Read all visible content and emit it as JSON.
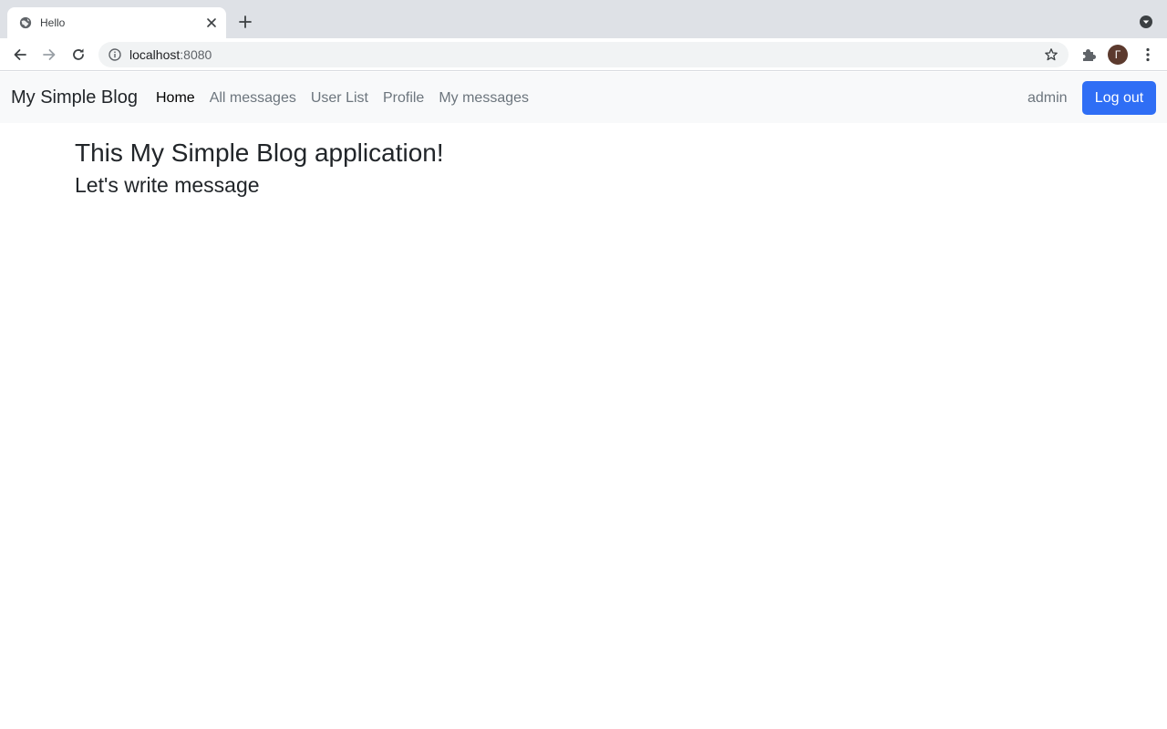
{
  "browser": {
    "tab": {
      "title": "Hello"
    },
    "address_bar": {
      "host": "localhost",
      "port": ":8080"
    },
    "profile_initial": "Г",
    "icons": {
      "favicon": "globe-icon",
      "tab_close": "close-icon",
      "new_tab": "plus-icon",
      "tab_search": "chevron-down-circle-icon",
      "back": "arrow-left-icon",
      "forward": "arrow-right-icon",
      "reload": "reload-icon",
      "site_info": "info-icon",
      "bookmark": "star-icon",
      "extensions": "puzzle-icon",
      "menu": "more-vertical-icon"
    }
  },
  "navbar": {
    "brand": "My Simple Blog",
    "links": [
      {
        "label": "Home",
        "active": true
      },
      {
        "label": "All messages",
        "active": false
      },
      {
        "label": "User List",
        "active": false
      },
      {
        "label": "Profile",
        "active": false
      },
      {
        "label": "My messages",
        "active": false
      }
    ],
    "username": "admin",
    "logout_label": "Log out"
  },
  "main": {
    "heading": "This My Simple Blog application!",
    "subheading": "Let's write message"
  },
  "colors": {
    "primary": "#2f6ef5",
    "navbar_bg": "#f8f9fa",
    "text": "#212529",
    "muted": "#6c757d",
    "chrome_bg": "#dee1e6"
  }
}
